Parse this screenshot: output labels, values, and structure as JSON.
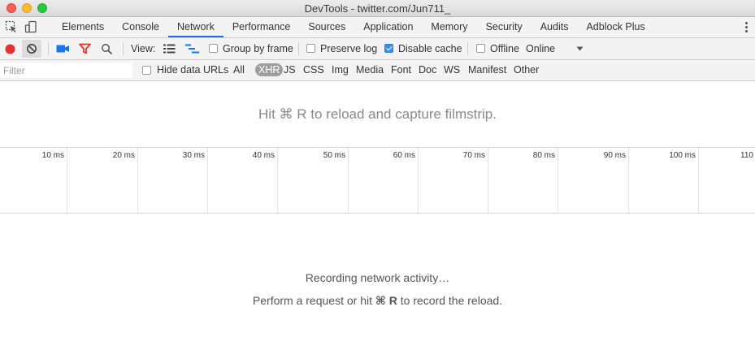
{
  "window": {
    "title": "DevTools - twitter.com/Jun711_"
  },
  "tabs": [
    {
      "label": "Elements",
      "active": false
    },
    {
      "label": "Console",
      "active": false
    },
    {
      "label": "Network",
      "active": true
    },
    {
      "label": "Performance",
      "active": false
    },
    {
      "label": "Sources",
      "active": false
    },
    {
      "label": "Application",
      "active": false
    },
    {
      "label": "Memory",
      "active": false
    },
    {
      "label": "Security",
      "active": false
    },
    {
      "label": "Audits",
      "active": false
    },
    {
      "label": "Adblock Plus",
      "active": false
    }
  ],
  "toolbar": {
    "view_label": "View:",
    "group_by_frame": {
      "label": "Group by frame",
      "checked": false
    },
    "preserve_log": {
      "label": "Preserve log",
      "checked": false
    },
    "disable_cache": {
      "label": "Disable cache",
      "checked": true
    },
    "offline": {
      "label": "Offline",
      "checked": false
    },
    "throttling": "Online"
  },
  "filterbar": {
    "placeholder": "Filter",
    "hide_data_urls": {
      "label": "Hide data URLs",
      "checked": false
    },
    "types": [
      {
        "label": "All",
        "active": false
      },
      {
        "label": "XHR",
        "active": true
      },
      {
        "label": "JS",
        "active": false
      },
      {
        "label": "CSS",
        "active": false
      },
      {
        "label": "Img",
        "active": false
      },
      {
        "label": "Media",
        "active": false
      },
      {
        "label": "Font",
        "active": false
      },
      {
        "label": "Doc",
        "active": false
      },
      {
        "label": "WS",
        "active": false
      },
      {
        "label": "Manifest",
        "active": false
      },
      {
        "label": "Other",
        "active": false
      }
    ]
  },
  "filmstrip": {
    "message": "Hit ⌘ R to reload and capture filmstrip."
  },
  "timeline": {
    "ticks": [
      "10 ms",
      "20 ms",
      "30 ms",
      "40 ms",
      "50 ms",
      "60 ms",
      "70 ms",
      "80 ms",
      "90 ms",
      "100 ms",
      "110"
    ]
  },
  "status": {
    "recording": "Recording network activity…",
    "hint_prefix": "Perform a request or hit ",
    "hint_key": "⌘ R",
    "hint_suffix": " to record the reload."
  },
  "colors": {
    "record": "#e8322f",
    "accent": "#1a73e8",
    "filter_icon": "#e8322f"
  },
  "icons": {
    "inspect": "inspect-element-icon",
    "device": "device-toolbar-icon",
    "record": "record-icon",
    "clear": "clear-icon",
    "capture": "capture-screenshots-icon",
    "filter": "filter-icon",
    "search": "search-icon",
    "large_rows": "large-rows-icon",
    "waterfall": "waterfall-overview-icon",
    "dropdown": "dropdown-arrow-icon",
    "more": "more-options-icon"
  }
}
